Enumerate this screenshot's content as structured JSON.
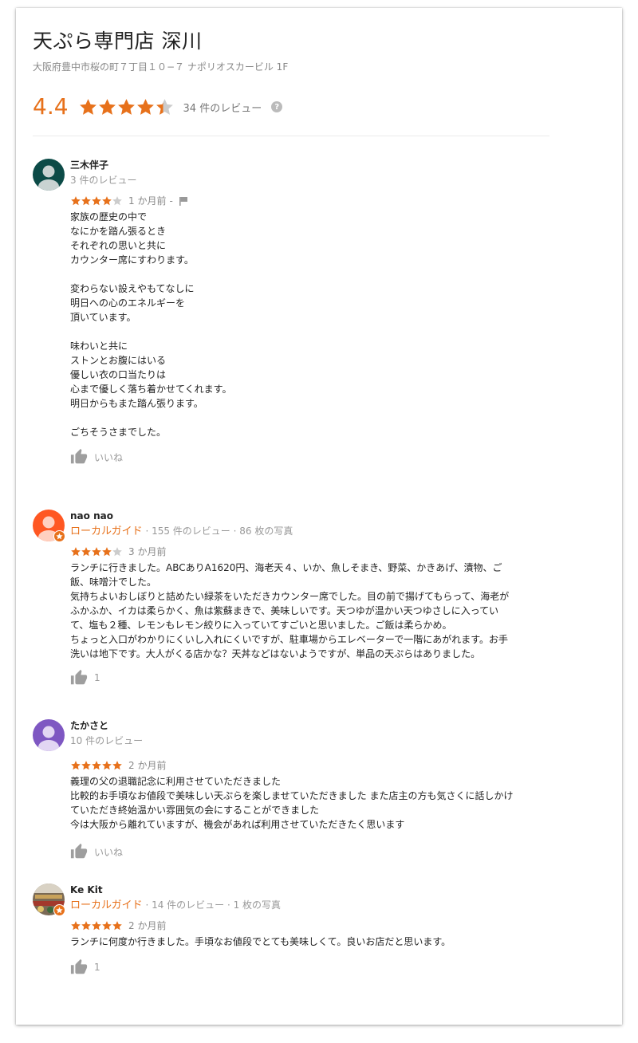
{
  "place": {
    "name": "天ぷら専門店 深川",
    "address": "大阪府豊中市桜の町７丁目１０−７ ナポリオスカービル 1F",
    "rating": "4.4",
    "rating_fraction": 0.88,
    "review_count_label": "34 件のレビュー",
    "help_icon_label": "?"
  },
  "colors": {
    "accent": "#e7711b",
    "star_empty": "#cccccc"
  },
  "reviews": [
    {
      "author": "三木伴子",
      "meta": "3 件のレビュー",
      "stars": 4,
      "time": "1 か月前",
      "sep": "-",
      "flag_icon": "flag-icon",
      "avatar_color": "#0c4b47",
      "text": "家族の歴史の中で\nなにかを踏ん張るとき\nそれぞれの思いと共に\nカウンター席にすわります。\n\n変わらない設えやもてなしに\n明日への心のエネルギーを\n頂いています。\n\n味わいと共に\nストンとお腹にはいる\n優しい衣の口当たりは\n心まで優しく落ち着かせてくれます。\n明日からもまた踏ん張ります。\n\nごちそうさまでした。",
      "like_label": "いいね"
    },
    {
      "author": "nao nao",
      "guide": "ローカルガイド",
      "meta": " · 155 件のレビュー · 86 枚の写真",
      "stars": 4,
      "time": "3 か月前",
      "avatar_color": "#ff5722",
      "text": "ランチに行きました。ABCありA1620円、海老天４、いか、魚しそまき、野菜、かきあげ、漬物、ご\n飯、味噌汁でした。\n気持ちよいおしぼりと詰めたい緑茶をいただきカウンター席でした。目の前で揚げてもらって、海老が\nふかふか、イカは柔らかく、魚は紫蘇まきで、美味しいです。天つゆが温かい天つゆさしに入ってい\nて、塩も２種、レモンもレモン絞りに入っていてすごいと思いました。ご飯は柔らかめ。\nちょっと入口がわかりにくいし入れにくいですが、駐車場からエレベーターで一階にあがれます。お手\n洗いは地下です。大人がくる店かな？天丼などはないようですが、単品の天ぷらはありました。",
      "like_label": "1"
    },
    {
      "author": "たかさと",
      "meta": "10 件のレビュー",
      "stars": 5,
      "time": "2 か月前",
      "avatar_color": "#7e57c2",
      "text": "義理の父の退職記念に利用させていただきました\n比較的お手頃なお値段で美味しい天ぷらを楽しませていただきました また店主の方も気さくに話しかけ\nていただき終始温かい雰囲気の会にすることができました\n今は大阪から離れていますが、機会があれば利用させていただきたく思います",
      "like_label": "いいね"
    },
    {
      "author": "Ke Kit",
      "guide": "ローカルガイド",
      "meta": " · 14 件のレビュー · 1 枚の写真",
      "stars": 5,
      "time": "2 か月前",
      "text": "ランチに何度か行きました。手頃なお値段でとても美味しくて。良いお店だと思います。",
      "like_label": "1"
    }
  ]
}
